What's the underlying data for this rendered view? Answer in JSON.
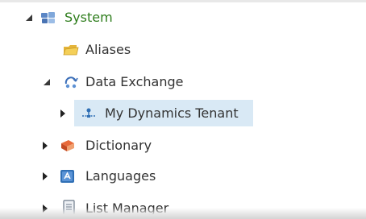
{
  "tree": {
    "items": [
      {
        "label": "System",
        "expanded": true,
        "icon": "system-icon"
      },
      {
        "label": "Aliases",
        "icon": "folder-icon"
      },
      {
        "label": "Data Exchange",
        "expanded": true,
        "icon": "data-exchange-icon"
      },
      {
        "label": "My Dynamics Tenant",
        "expanded": false,
        "selected": true,
        "icon": "tenant-icon"
      },
      {
        "label": "Dictionary",
        "expanded": false,
        "icon": "dictionary-icon"
      },
      {
        "label": "Languages",
        "expanded": false,
        "icon": "languages-icon"
      },
      {
        "label": "List Manager",
        "expanded": false,
        "icon": "list-manager-icon"
      }
    ]
  },
  "colors": {
    "selection": "#d9e9f5",
    "root_label": "#2e7d1c",
    "text": "#333333"
  }
}
